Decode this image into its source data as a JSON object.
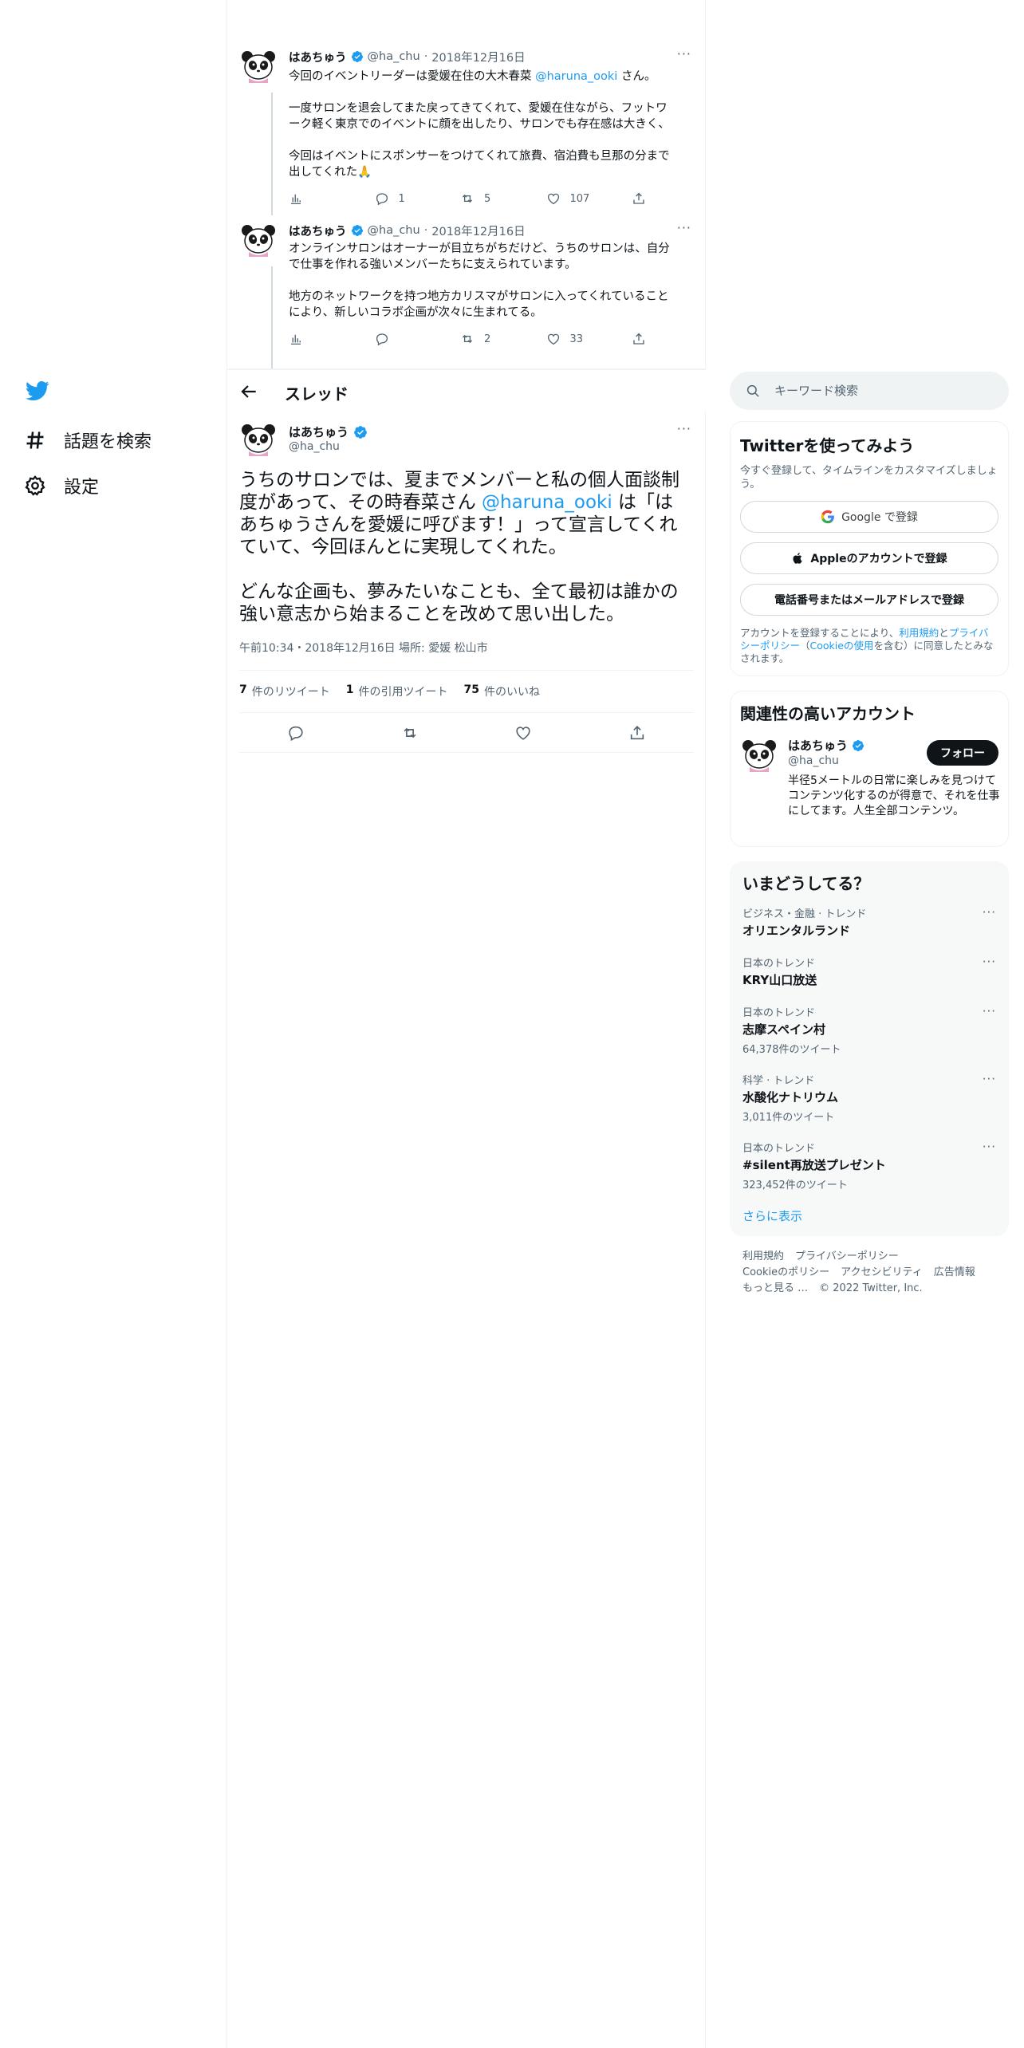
{
  "nav": {
    "explore_label": "話題を検索",
    "settings_label": "設定"
  },
  "thread_tweets": [
    {
      "name": "はあちゅう",
      "handle": "@ha_chu",
      "sep": "·",
      "date": "2018年12月16日",
      "body_line1_pre": "今回のイベントリーダーは愛媛在住の大木春菜 ",
      "body_line1_mention": "@haruna_ooki",
      "body_line1_post": " さん。",
      "body_p2": "一度サロンを退会してまた戻ってきてくれて、愛媛在住ながら、フットワーク軽く東京でのイベントに顔を出したり、サロンでも存在感は大きく、",
      "body_p3": "今回はイベントにスポンサーをつけてくれて旅費、宿泊費も旦那の分まで出してくれた🙏",
      "replies": "1",
      "retweets": "5",
      "likes": "107"
    },
    {
      "name": "はあちゅう",
      "handle": "@ha_chu",
      "sep": "·",
      "date": "2018年12月16日",
      "body_p1": "オンラインサロンはオーナーが目立ちがちだけど、うちのサロンは、自分で仕事を作れる強いメンバーたちに支えられています。",
      "body_p2": "地方のネットワークを持つ地方カリスマがサロンに入ってくれていることにより、新しいコラボ企画が次々に生まれてる。",
      "replies": "",
      "retweets": "2",
      "likes": "33"
    }
  ],
  "thread_header": {
    "title": "スレッド"
  },
  "focal": {
    "name": "はあちゅう",
    "handle": "@ha_chu",
    "text_pre": "うちのサロンでは、夏までメンバーと私の個人面談制度があって、その時春菜さん ",
    "text_mention": "@haruna_ooki",
    "text_post": " は「はあちゅうさんを愛媛に呼びます！」って宣言してくれていて、今回ほんとに実現してくれた。",
    "text_p2": "どんな企画も、夢みたいなことも、全て最初は誰かの強い意志から始まることを改めて思い出した。",
    "meta": "午前10:34・2018年12月16日 場所: 愛媛 松山市",
    "retweet_count": "7",
    "retweet_label": "件のリツイート",
    "quote_count": "1",
    "quote_label": "件の引用ツイート",
    "like_count": "75",
    "like_label": "件のいいね"
  },
  "search": {
    "placeholder": "キーワード検索"
  },
  "signup": {
    "title": "Twitterを使ってみよう",
    "subtitle": "今すぐ登録して、タイムラインをカスタマイズしましょう。",
    "google_label": "Google で登録",
    "apple_label": "Appleのアカウントで登録",
    "phone_label": "電話番号またはメールアドレスで登録",
    "legal_pre": "アカウントを登録することにより、",
    "legal_terms": "利用規約",
    "legal_and": "と",
    "legal_privacy": "プライバシーポリシー",
    "legal_mid": "（",
    "legal_cookie": "Cookieの使用",
    "legal_post": "を含む）に同意したとみなされます。"
  },
  "relevant": {
    "title": "関連性の高いアカウント",
    "name": "はあちゅう",
    "handle": "@ha_chu",
    "follow_label": "フォロー",
    "bio": "半径5メートルの日常に楽しみを見つけてコンテンツ化するのが得意で、それを仕事にしてます。人生全部コンテンツ。"
  },
  "trends": {
    "title": "いまどうしてる？",
    "items": [
      {
        "context": "ビジネス・金融 · トレンド",
        "topic": "オリエンタルランド",
        "count": ""
      },
      {
        "context": "日本のトレンド",
        "topic": "KRY山口放送",
        "count": ""
      },
      {
        "context": "日本のトレンド",
        "topic": "志摩スペイン村",
        "count": "64,378件のツイート"
      },
      {
        "context": "科学 · トレンド",
        "topic": "水酸化ナトリウム",
        "count": "3,011件のツイート"
      },
      {
        "context": "日本のトレンド",
        "topic": "#silent再放送プレゼント",
        "count": "323,452件のツイート"
      }
    ],
    "show_more": "さらに表示"
  },
  "footer": {
    "terms": "利用規約",
    "privacy": "プライバシーポリシー",
    "cookie": "Cookieのポリシー",
    "accessibility": "アクセシビリティ",
    "ads": "広告情報",
    "more": "もっと見る …",
    "copyright": "© 2022 Twitter, Inc."
  },
  "colors": {
    "accent": "#1d9bf0",
    "text": "#0f1419",
    "muted": "#536471",
    "border": "#eff3f4"
  },
  "icons": [
    "twitter-bird-icon",
    "hashtag-icon",
    "gear-icon",
    "verified-badge-icon",
    "analytics-icon",
    "reply-icon",
    "retweet-icon",
    "like-icon",
    "share-icon",
    "back-arrow-icon",
    "search-icon",
    "google-icon",
    "apple-icon",
    "more-icon"
  ]
}
